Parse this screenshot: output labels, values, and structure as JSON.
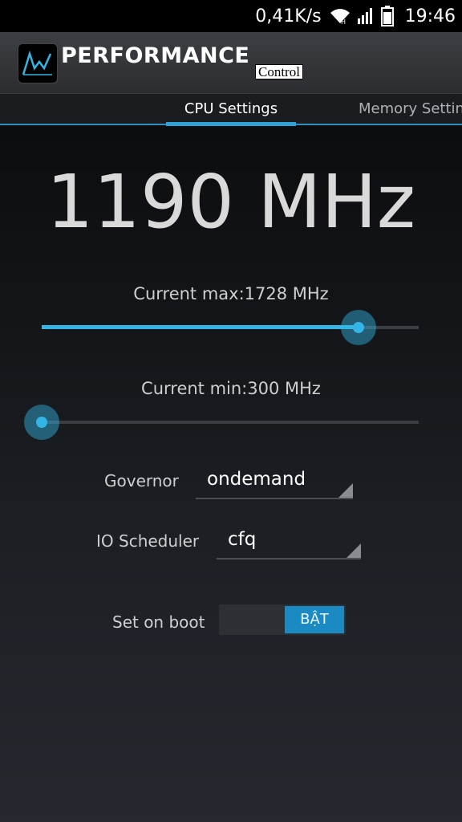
{
  "status_bar": {
    "speed": "0,41K/s",
    "time": "19:46",
    "icons": [
      "wifi-icon",
      "signal-icon",
      "battery-icon"
    ]
  },
  "action_bar": {
    "app_title": "PERFORMANCE",
    "app_subtitle": "Control"
  },
  "tabs": [
    {
      "label": "CPU Settings",
      "active": true
    },
    {
      "label": "Memory Settings",
      "active": false
    }
  ],
  "cpu": {
    "current_freq": "1190 MHz",
    "max_label": "Current max:1728 MHz",
    "max_fraction": 0.84,
    "min_label": "Current min:300 MHz",
    "min_fraction": 0.0,
    "governor_label": "Governor",
    "governor_value": "ondemand",
    "io_label": "IO Scheduler",
    "io_value": "cfq",
    "boot_label": "Set on boot",
    "boot_toggle": "BẬT"
  },
  "colors": {
    "accent": "#33b5e5",
    "toggle_on": "#1b8ac3"
  }
}
